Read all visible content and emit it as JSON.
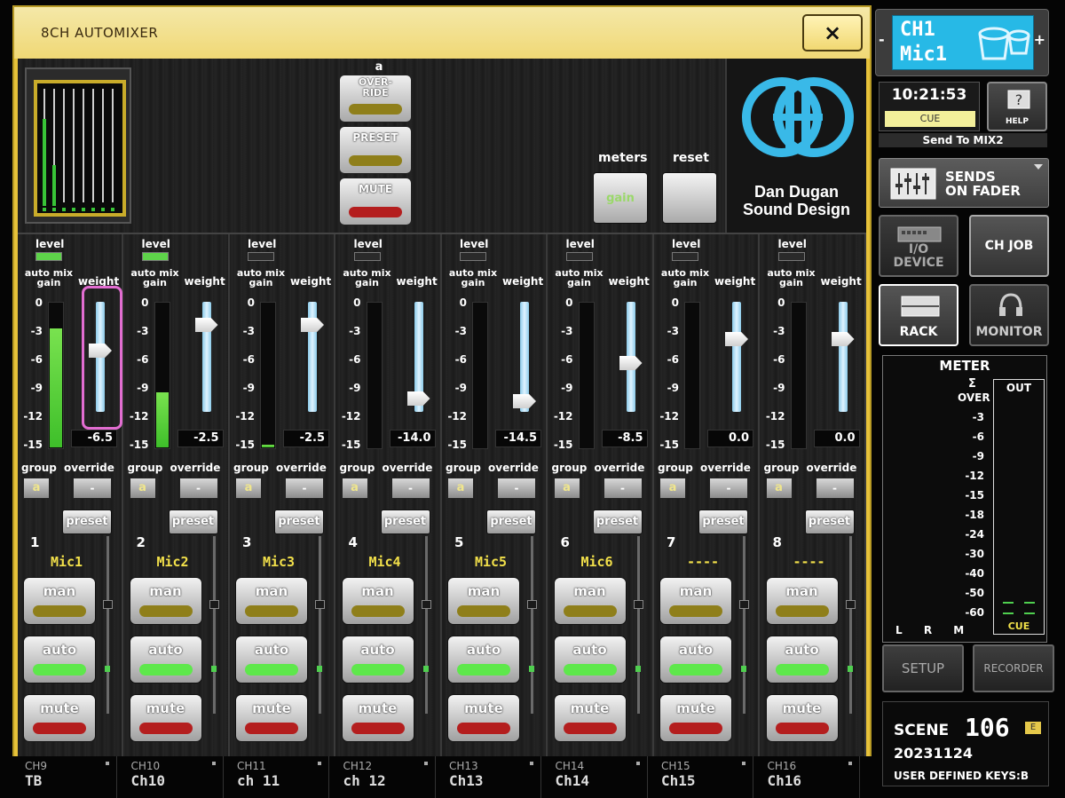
{
  "window": {
    "title": "8CH AUTOMIXER",
    "close_label": "×"
  },
  "top": {
    "group_label": "a",
    "override_label": "OVER-\nRIDE",
    "preset_label": "PRESET",
    "mute_label": "MUTE",
    "meters_label": "meters",
    "reset_label": "reset",
    "gain_label": "gain",
    "logo_line1": "Dan Dugan",
    "logo_line2": "Sound Design"
  },
  "strip_labels": {
    "level": "level",
    "auto_mix_gain": "auto mix gain",
    "weight": "weight",
    "group": "group",
    "override": "override",
    "preset": "preset",
    "man": "man",
    "auto": "auto",
    "mute": "mute",
    "scale": [
      "0",
      "-3",
      "-6",
      "-9",
      "-12",
      "-15"
    ]
  },
  "channels": [
    {
      "num": "1",
      "name": "Mic1",
      "group": "a",
      "override": "-",
      "weight": "-6.5",
      "weight_db": -6.5,
      "gain_level": 0.82,
      "level_on": true
    },
    {
      "num": "2",
      "name": "Mic2",
      "group": "a",
      "override": "-",
      "weight": "-2.5",
      "weight_db": -2.5,
      "gain_level": 0.38,
      "level_on": true
    },
    {
      "num": "3",
      "name": "Mic3",
      "group": "a",
      "override": "-",
      "weight": "-2.5",
      "weight_db": -2.5,
      "gain_level": 0.02,
      "level_on": false
    },
    {
      "num": "4",
      "name": "Mic4",
      "group": "a",
      "override": "-",
      "weight": "-14.0",
      "weight_db": -14.0,
      "gain_level": 0,
      "level_on": false
    },
    {
      "num": "5",
      "name": "Mic5",
      "group": "a",
      "override": "-",
      "weight": "-14.5",
      "weight_db": -14.5,
      "gain_level": 0,
      "level_on": false
    },
    {
      "num": "6",
      "name": "Mic6",
      "group": "a",
      "override": "-",
      "weight": "-8.5",
      "weight_db": -8.5,
      "gain_level": 0,
      "level_on": false
    },
    {
      "num": "7",
      "name": "----",
      "group": "a",
      "override": "-",
      "weight": "0.0",
      "weight_db": 0.0,
      "gain_level": 0,
      "level_on": false
    },
    {
      "num": "8",
      "name": "----",
      "group": "a",
      "override": "-",
      "weight": "0.0",
      "weight_db": 0.0,
      "gain_level": 0,
      "level_on": false
    }
  ],
  "sidebar": {
    "ch_num": "CH1",
    "ch_name": "Mic1",
    "minus": "-",
    "plus": "+",
    "clock": "10:21:53",
    "cue": "CUE",
    "help": "HELP",
    "send_to": "Send To MIX2",
    "sends_on_fader": "SENDS\nON FADER",
    "io_device": "I/O\nDEVICE",
    "ch_job": "CH JOB",
    "rack": "RACK",
    "monitor": "MONITOR",
    "meter_title": "METER",
    "sigma": "Σ",
    "over": "OVER",
    "out": "OUT",
    "meter_cue": "CUE",
    "meter_scale": [
      "-3",
      "-6",
      "-9",
      "-12",
      "-15",
      "-18",
      "-24",
      "-30",
      "-40",
      "-50",
      "-60"
    ],
    "lrm": "L R M",
    "setup": "SETUP",
    "recorder": "RECORDER",
    "scene_label": "SCENE",
    "scene_num": "106",
    "scene_flag": "E",
    "scene_date": "20231124",
    "user_keys": "USER DEFINED KEYS:B"
  },
  "channel_bar": [
    {
      "id": "CH9",
      "name": "TB"
    },
    {
      "id": "CH10",
      "name": "Ch10"
    },
    {
      "id": "CH11",
      "name": "ch 11"
    },
    {
      "id": "CH12",
      "name": "ch 12"
    },
    {
      "id": "CH13",
      "name": "Ch13"
    },
    {
      "id": "CH14",
      "name": "Ch14"
    },
    {
      "id": "CH15",
      "name": "Ch15"
    },
    {
      "id": "CH16",
      "name": "Ch16"
    }
  ],
  "colors": {
    "panel": "#e7c23a",
    "meter_green": "#4fcf4f",
    "led_yellow": "#8f7f1a",
    "led_red": "#b41e1e",
    "led_green": "#5ee84b",
    "highlight": "#e26dd1",
    "sel_blue": "#27b9e6"
  }
}
